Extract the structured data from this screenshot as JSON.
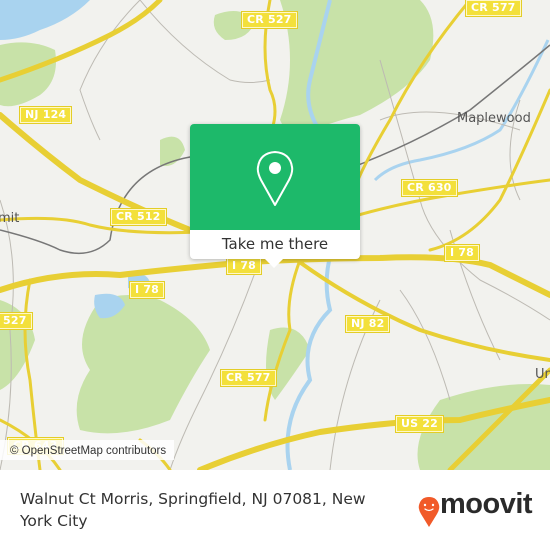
{
  "map": {
    "colors": {
      "background": "#f2f2ee",
      "park": "#c8e2a8",
      "water": "#a9d3ef",
      "road": "#f3e03b",
      "minor_road": "#bdbab3",
      "rail": "#777777",
      "popup_green": "#1db96a",
      "moovit_orange": "#f15a29"
    },
    "shields": [
      {
        "id": "cr577-top",
        "label": "CR 577"
      },
      {
        "id": "cr527",
        "label": "CR 527"
      },
      {
        "id": "nj124",
        "label": "NJ 124"
      },
      {
        "id": "cr512",
        "label": "CR 512"
      },
      {
        "id": "cr630",
        "label": "CR 630"
      },
      {
        "id": "i78-center",
        "label": "I 78"
      },
      {
        "id": "i78-right",
        "label": "I 78"
      },
      {
        "id": "i78-left",
        "label": "I 78"
      },
      {
        "id": "cr527-left",
        "label": "527"
      },
      {
        "id": "nj82",
        "label": "NJ 82"
      },
      {
        "id": "cr577-mid",
        "label": "CR 577"
      },
      {
        "id": "us22",
        "label": "US 22"
      },
      {
        "id": "cr643",
        "label": "CR 643"
      }
    ],
    "places": [
      {
        "id": "maplewood",
        "label": "Maplewood"
      },
      {
        "id": "summit",
        "label": "mit"
      },
      {
        "id": "union",
        "label": "Un"
      }
    ],
    "attribution": "© OpenStreetMap contributors"
  },
  "popup": {
    "icon": "map-pin-icon",
    "cta_label": "Take me there"
  },
  "footer": {
    "address": "Walnut Ct Morris, Springfield, NJ 07081, New York City",
    "logo_text": "moovit",
    "logo_icon": "moovit-pin-smile-icon"
  }
}
